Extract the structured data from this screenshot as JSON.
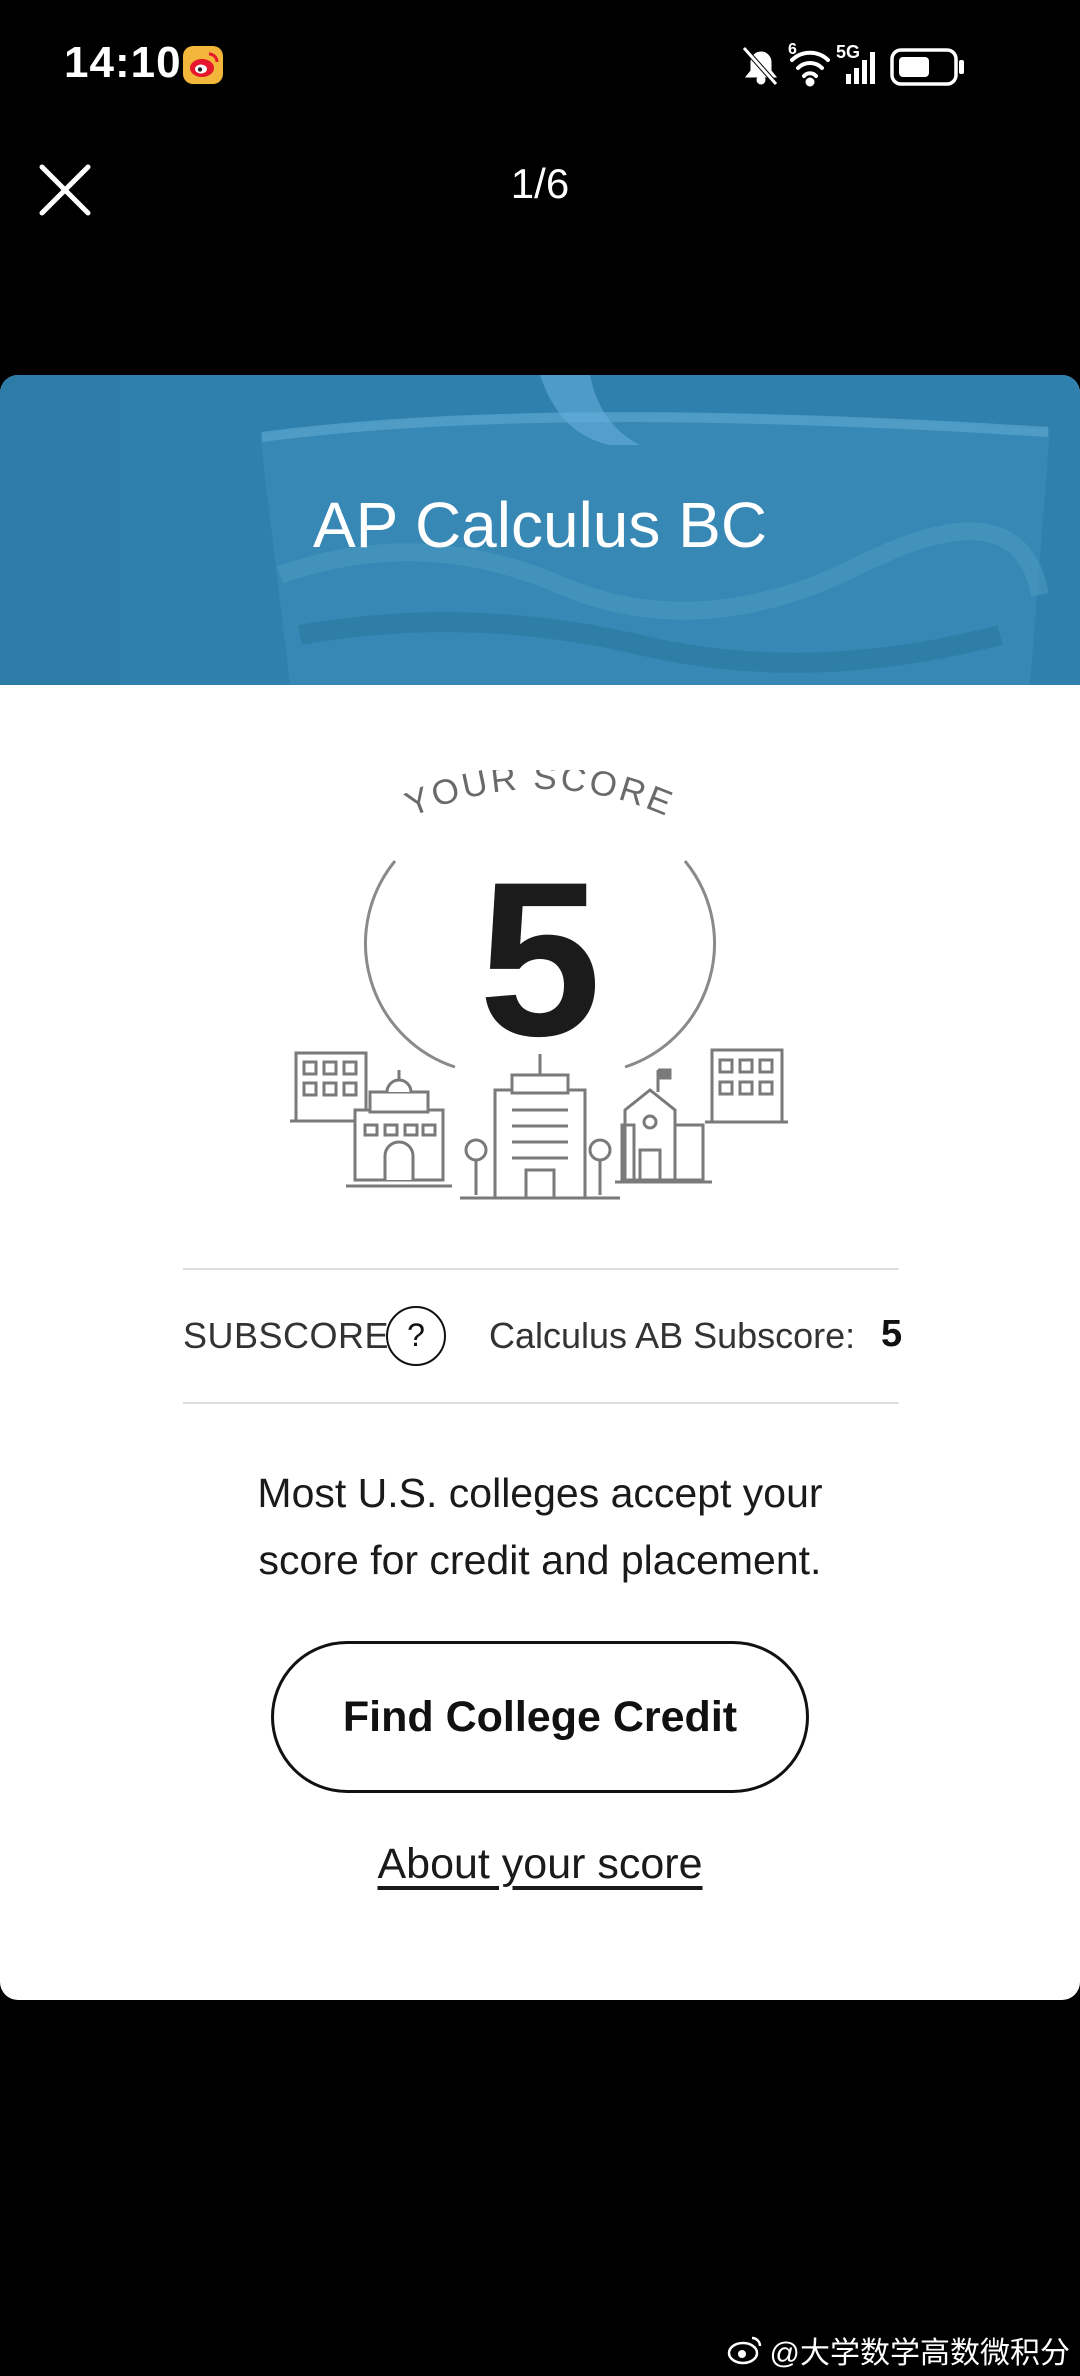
{
  "status_bar": {
    "time": "14:10",
    "network": "5G",
    "signal_sub": "6"
  },
  "viewer": {
    "page_counter": "1/6"
  },
  "card": {
    "title": "AP Calculus BC",
    "score_arc_label": "YOUR SCORE",
    "score": "5",
    "subscore_label": "SUBSCORE",
    "help_symbol": "?",
    "subscore_text": "Calculus AB Subscore:",
    "subscore_value": "5",
    "message_line1": "Most U.S. colleges accept your",
    "message_line2": "score for credit and placement.",
    "cta_label": "Find College Credit",
    "about_link": "About your score"
  },
  "watermark": "@大学数学高数微积分",
  "colors": {
    "hero": "#2f80ad",
    "background": "#000000",
    "card": "#ffffff"
  },
  "icons": [
    "weibo-icon",
    "mute-icon",
    "wifi-icon",
    "signal-icon",
    "battery-icon",
    "close-icon",
    "question-icon",
    "building-icon"
  ]
}
